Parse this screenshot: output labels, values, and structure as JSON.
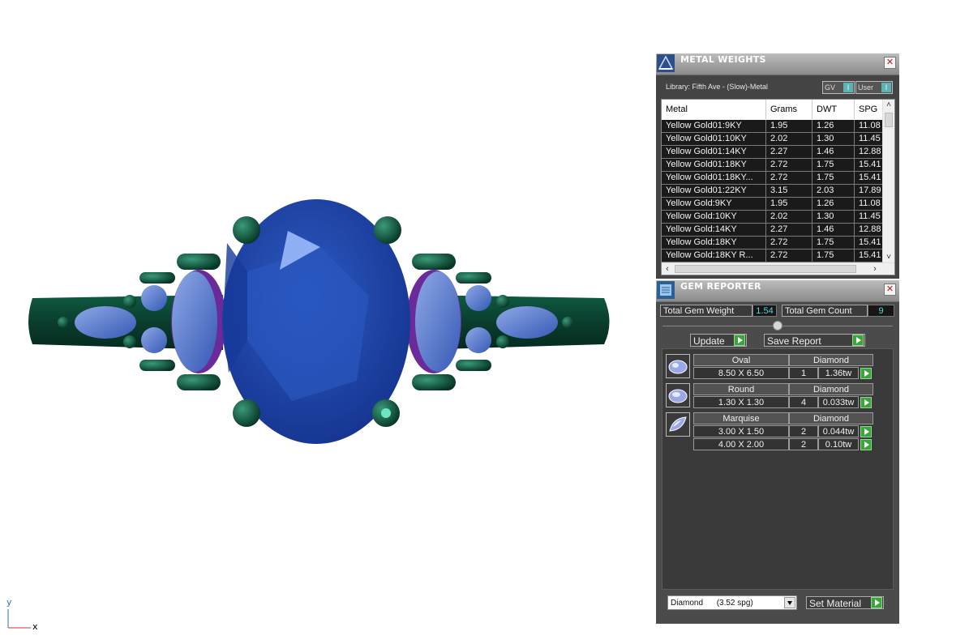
{
  "viewport": {
    "axis_y_label": "y",
    "axis_x_label": "x"
  },
  "metal_weights": {
    "title": "METAL WEIGHTS",
    "library": "Library: Fifth Ave - (Slow)-Metal",
    "toggle_gv": "GV",
    "toggle_user": "User",
    "toggle_glyph": "I",
    "columns": [
      "Metal",
      "Grams",
      "DWT",
      "SPG"
    ],
    "rows": [
      [
        "Yellow Gold01:9KY",
        "1.95",
        "1.26",
        "11.08"
      ],
      [
        "Yellow Gold01:10KY",
        "2.02",
        "1.30",
        "11.45"
      ],
      [
        "Yellow Gold01:14KY",
        "2.27",
        "1.46",
        "12.88"
      ],
      [
        "Yellow Gold01:18KY",
        "2.72",
        "1.75",
        "15.41"
      ],
      [
        "Yellow Gold01:18KY...",
        "2.72",
        "1.75",
        "15.41"
      ],
      [
        "Yellow Gold01:22KY",
        "3.15",
        "2.03",
        "17.89"
      ],
      [
        "Yellow Gold:9KY",
        "1.95",
        "1.26",
        "11.08"
      ],
      [
        "Yellow Gold:10KY",
        "2.02",
        "1.30",
        "11.45"
      ],
      [
        "Yellow Gold:14KY",
        "2.27",
        "1.46",
        "12.88"
      ],
      [
        "Yellow Gold:18KY",
        "2.72",
        "1.75",
        "15.41"
      ],
      [
        "Yellow Gold:18KY R...",
        "2.72",
        "1.75",
        "15.41"
      ]
    ]
  },
  "gem_reporter": {
    "title": "GEM REPORTER",
    "total_weight_label": "Total Gem Weight",
    "total_weight_value": "1.54",
    "total_count_label": "Total Gem Count",
    "total_count_value": "9",
    "update_label": "Update",
    "save_report_label": "Save Report",
    "gems": [
      {
        "shape": "Oval",
        "material": "Diamond",
        "sizes": [
          {
            "size": "8.50 X 6.50",
            "count": "1",
            "weight": "1.36tw"
          }
        ]
      },
      {
        "shape": "Round",
        "material": "Diamond",
        "sizes": [
          {
            "size": "1.30 X 1.30",
            "count": "4",
            "weight": "0.033tw"
          }
        ]
      },
      {
        "shape": "Marquise",
        "material": "Diamond",
        "sizes": [
          {
            "size": "3.00 X 1.50",
            "count": "2",
            "weight": "0.044tw"
          },
          {
            "size": "4.00 X 2.00",
            "count": "2",
            "weight": "0.10tw"
          }
        ]
      }
    ],
    "material_select": "Diamond      (3.52 spg)",
    "set_material_label": "Set Material"
  },
  "colors": {
    "metal_green": "#0d4a37",
    "gem_blue": "#1d3fa3",
    "accent_teal": "#5fd3d6",
    "play_green": "#3aa53a"
  }
}
